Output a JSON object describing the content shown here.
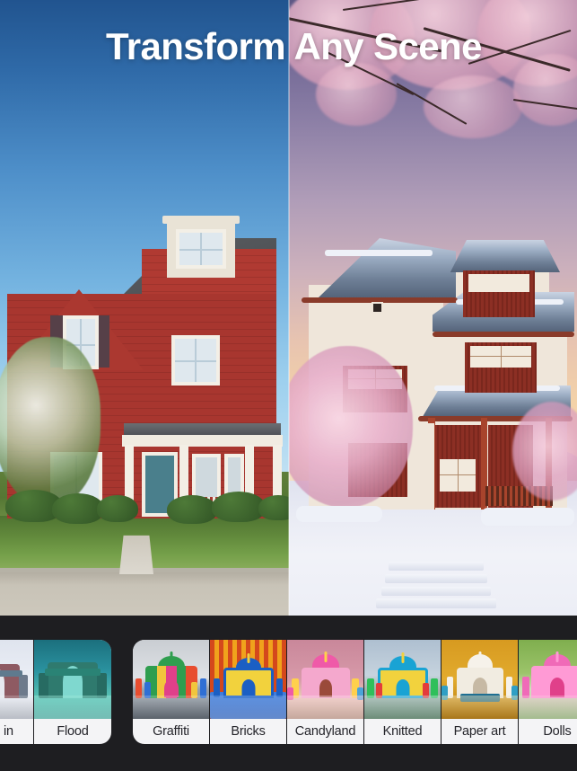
{
  "hero": {
    "title": "Transform Any Scene",
    "left_image": {
      "name": "original-house-photo",
      "description": "Red two-story American colonial house with white trim, gray shingle roof and teal front door under a clear blue sky",
      "sky_top_color": "#21548f",
      "sky_bottom_color": "#cfe7f5",
      "house_color": "#a8362f"
    },
    "right_image": {
      "name": "transformed-house-photo",
      "description": "Japanese style house with cream walls, dark red wood panels and tiled roofs, cherry blossoms and snow at sunset",
      "sky_top_color": "#5d5886",
      "sky_bottom_color": "#f7dfb9",
      "house_color": "#efe6da"
    }
  },
  "carousel": {
    "background_color": "#1e1e21",
    "card_background": "#f4f4f6",
    "label_color": "#24242a",
    "groups": [
      {
        "name": "style-group-left",
        "cards": [
          {
            "label": "wed in",
            "truncated": true,
            "theme": "snow",
            "colors": [
              "#dfe4ee",
              "#8e5a62",
              "#b8c7d4"
            ]
          },
          {
            "label": "Flood",
            "truncated": false,
            "theme": "underwater",
            "colors": [
              "#1b6f7d",
              "#2fa898",
              "#9fe8dc"
            ]
          }
        ]
      },
      {
        "name": "style-group-right",
        "cards": [
          {
            "label": "Graffiti",
            "truncated": false,
            "theme": "graffiti",
            "colors": [
              "#c9cdd2",
              "#2f9e4f",
              "#e0408a"
            ]
          },
          {
            "label": "Bricks",
            "truncated": false,
            "theme": "lego-blue",
            "colors": [
              "#d4481c",
              "#f0a21c",
              "#1b5fc4"
            ]
          },
          {
            "label": "Candyland",
            "truncated": false,
            "theme": "candy",
            "colors": [
              "#c9879a",
              "#ef5aa8",
              "#ffd04d"
            ]
          },
          {
            "label": "Knitted",
            "truncated": false,
            "theme": "knitted",
            "colors": [
              "#aebfd0",
              "#19a3d4",
              "#2fbf5a"
            ]
          },
          {
            "label": "Paper art",
            "truncated": false,
            "theme": "paper-gold",
            "colors": [
              "#d79a20",
              "#f6f2ea",
              "#2f9fc4"
            ]
          },
          {
            "label": "Dolls",
            "truncated": true,
            "theme": "dolls-pink",
            "colors": [
              "#7fae4e",
              "#f06ab8",
              "#ff9ad5"
            ]
          }
        ]
      }
    ]
  }
}
